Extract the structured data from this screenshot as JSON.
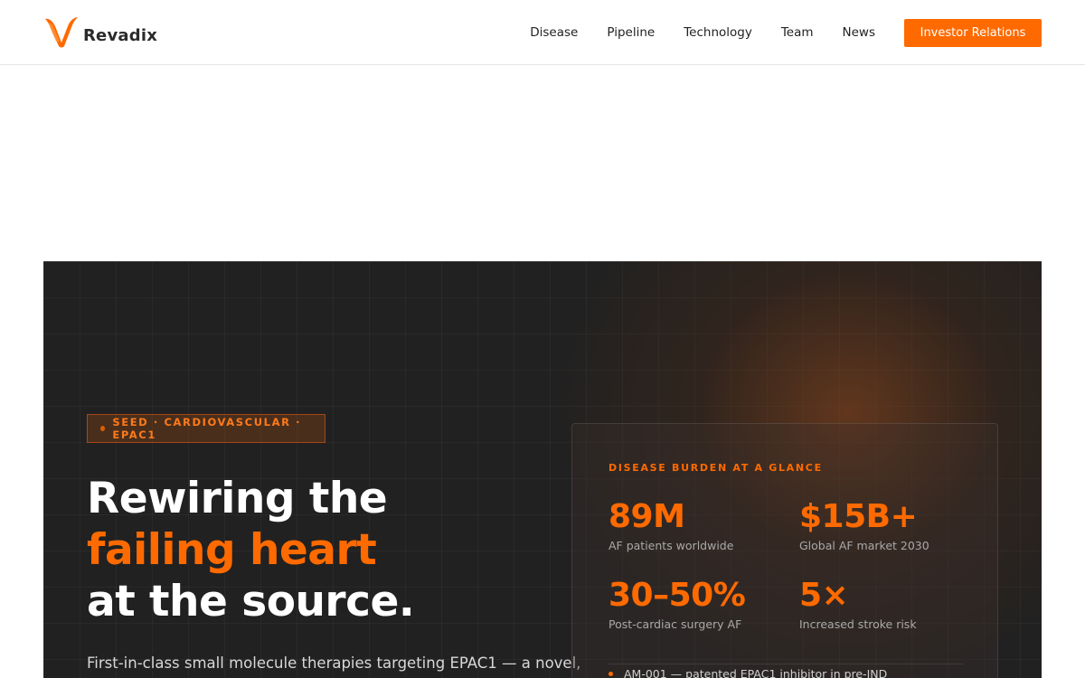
{
  "brand": {
    "name": "Revadix",
    "accent_color": "#ff6a00",
    "logo_icon": "flame-v-logo-icon"
  },
  "nav": {
    "links": [
      "Disease",
      "Pipeline",
      "Technology",
      "Team",
      "News"
    ],
    "cta": "Investor Relations"
  },
  "hero": {
    "badge": "SEED · CARDIOVASCULAR · EPAC1",
    "headline": {
      "line1": "Rewiring the",
      "line2": "failing heart",
      "line3": "at the source."
    },
    "description": "First-in-class small molecule therapies targeting EPAC1 — a novel,"
  },
  "stats_card": {
    "title": "DISEASE BURDEN AT A GLANCE",
    "stats": [
      {
        "value": "89M",
        "label": "AF patients worldwide"
      },
      {
        "value": "$15B+",
        "label": "Global AF market 2030"
      },
      {
        "value": "30–50%",
        "label": "Post-cardiac surgery AF"
      },
      {
        "value": "5×",
        "label": "Increased stroke risk"
      }
    ],
    "bullet": "AM-001 — patented EPAC1 inhibitor in pre-IND"
  }
}
